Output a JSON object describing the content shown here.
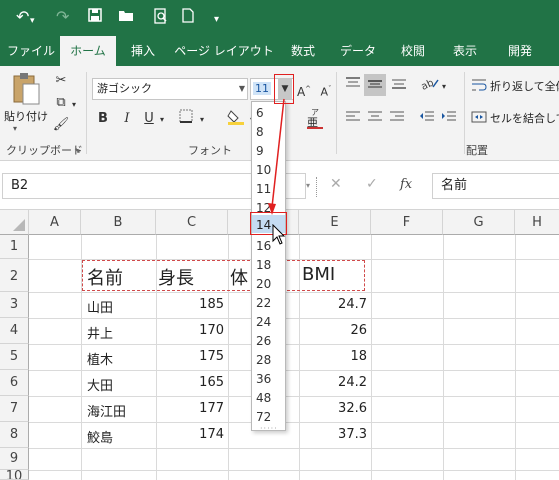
{
  "quick_access": {
    "undo": "↶",
    "redo": "↷",
    "save": "💾",
    "open": "📂",
    "print_preview": "🔍",
    "new": "🗋",
    "customize": "▾"
  },
  "tabs": [
    {
      "label": "ファイル",
      "active": false
    },
    {
      "label": "ホーム",
      "active": true
    },
    {
      "label": "挿入",
      "active": false
    },
    {
      "label": "ページ レイアウト",
      "active": false
    },
    {
      "label": "数式",
      "active": false
    },
    {
      "label": "データ",
      "active": false
    },
    {
      "label": "校閲",
      "active": false
    },
    {
      "label": "表示",
      "active": false
    },
    {
      "label": "開発",
      "active": false
    }
  ],
  "ribbon": {
    "clipboard": {
      "paste_label": "貼り付け",
      "group_label": "クリップボード"
    },
    "font": {
      "font_name": "游ゴシック",
      "font_size": "11",
      "bold": "B",
      "italic": "I",
      "underline": "U",
      "group_label": "フォント"
    },
    "alignment": {
      "wrap_text": "折り返して全体",
      "merge_center": "セルを結合して",
      "group_label": "配置"
    }
  },
  "formula_bar": {
    "name_box": "B2",
    "fx": "fx",
    "content": "名前"
  },
  "columns": [
    "A",
    "B",
    "C",
    "D",
    "E",
    "F",
    "G",
    "H"
  ],
  "rows": [
    "1",
    "2",
    "3",
    "4",
    "5",
    "6",
    "7",
    "8",
    "9",
    "10"
  ],
  "table": {
    "headers": [
      "名前",
      "身長",
      "体",
      "BMI"
    ],
    "names": [
      "山田",
      "井上",
      "植木",
      "大田",
      "海江田",
      "鮫島"
    ],
    "heights": [
      "185",
      "170",
      "175",
      "165",
      "177",
      "174"
    ],
    "bmi": [
      "24.7",
      "26",
      "18",
      "24.2",
      "32.6",
      "37.3"
    ]
  },
  "font_size_list": [
    "6",
    "8",
    "9",
    "10",
    "11",
    "12",
    "14",
    "16",
    "18",
    "20",
    "22",
    "24",
    "26",
    "28",
    "36",
    "48",
    "72"
  ],
  "selected_size": "14",
  "colors": {
    "excel_green": "#217346",
    "highlight_red": "#e02020",
    "ribbon_bg": "#f3f3f3"
  }
}
